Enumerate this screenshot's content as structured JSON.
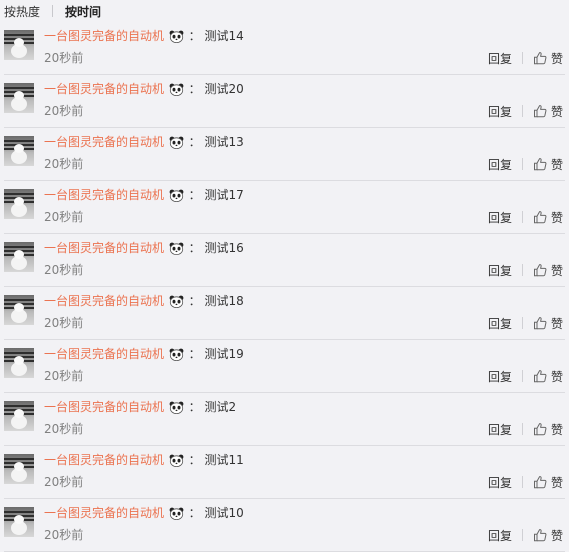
{
  "sort": {
    "hot_label": "按热度",
    "time_label": "按时间"
  },
  "comments": [
    {
      "user": "一台图灵完备的自动机",
      "colon": "：",
      "content": "测试14",
      "time": "20秒前",
      "reply": "回复",
      "like": "赞"
    },
    {
      "user": "一台图灵完备的自动机",
      "colon": "：",
      "content": "测试20",
      "time": "20秒前",
      "reply": "回复",
      "like": "赞"
    },
    {
      "user": "一台图灵完备的自动机",
      "colon": "：",
      "content": "测试13",
      "time": "20秒前",
      "reply": "回复",
      "like": "赞"
    },
    {
      "user": "一台图灵完备的自动机",
      "colon": "：",
      "content": "测试17",
      "time": "20秒前",
      "reply": "回复",
      "like": "赞"
    },
    {
      "user": "一台图灵完备的自动机",
      "colon": "：",
      "content": "测试16",
      "time": "20秒前",
      "reply": "回复",
      "like": "赞"
    },
    {
      "user": "一台图灵完备的自动机",
      "colon": "：",
      "content": "测试18",
      "time": "20秒前",
      "reply": "回复",
      "like": "赞"
    },
    {
      "user": "一台图灵完备的自动机",
      "colon": "：",
      "content": "测试19",
      "time": "20秒前",
      "reply": "回复",
      "like": "赞"
    },
    {
      "user": "一台图灵完备的自动机",
      "colon": "：",
      "content": "测试2",
      "time": "20秒前",
      "reply": "回复",
      "like": "赞"
    },
    {
      "user": "一台图灵完备的自动机",
      "colon": "：",
      "content": "测试11",
      "time": "20秒前",
      "reply": "回复",
      "like": "赞"
    },
    {
      "user": "一台图灵完备的自动机",
      "colon": "：",
      "content": "测试10",
      "time": "20秒前",
      "reply": "回复",
      "like": "赞"
    }
  ],
  "icons": {
    "avatar": "snowman-photo-avatar",
    "emoji": "panda-icon",
    "like": "thumbs-up-icon"
  },
  "colors": {
    "username": "#eb7350",
    "time": "#808080",
    "background": "#f2f2f5"
  }
}
